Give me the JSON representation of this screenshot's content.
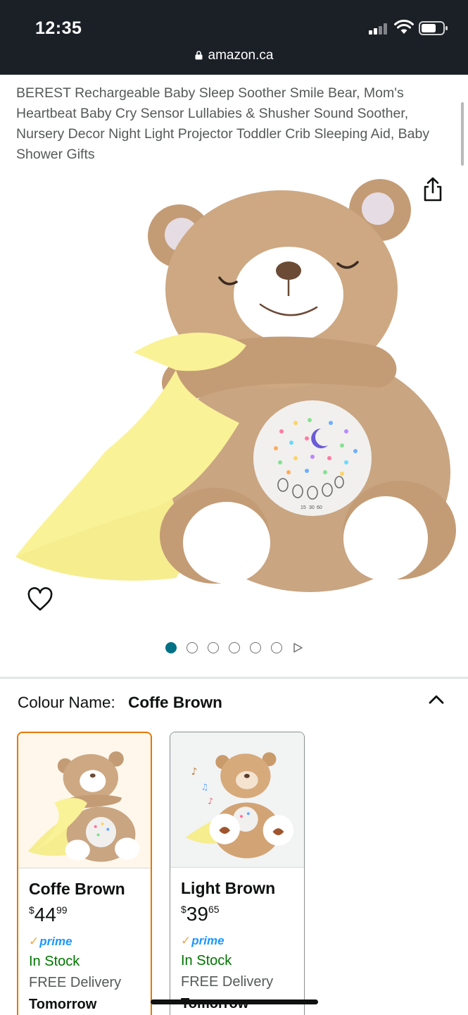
{
  "status_bar": {
    "time": "12:35"
  },
  "browser": {
    "url": "amazon.ca"
  },
  "product": {
    "title": "BEREST Rechargeable Baby Sleep Soother Smile Bear, Mom's Heartbeat Baby Cry Sensor Lullabies & Shusher Sound Soother, Nursery Decor Night Light Projector Toddler Crib Sleeping Aid, Baby Shower Gifts",
    "image": {
      "panel_labels": [
        "15",
        "30",
        "60"
      ]
    },
    "carousel": {
      "count": 6,
      "active_index": 0
    }
  },
  "variation": {
    "label": "Colour Name:",
    "selected": "Coffe Brown",
    "options": [
      {
        "name": "Coffe Brown",
        "price_currency": "$",
        "price_whole": "44",
        "price_fraction": "99",
        "prime": "prime",
        "stock": "In Stock",
        "delivery": "FREE Delivery",
        "delivery_when": "Tomorrow",
        "selected": true
      },
      {
        "name": "Light Brown",
        "price_currency": "$",
        "price_whole": "39",
        "price_fraction": "65",
        "prime": "prime",
        "stock": "In Stock",
        "delivery": "FREE Delivery",
        "delivery_when": "Tomorrow",
        "selected": false
      }
    ]
  },
  "colors": {
    "chrome_bg": "#1b2027",
    "selected_border": "#e77600",
    "dot_active": "#007185",
    "prime_blue": "#1a98ff",
    "stock_green": "#007600"
  }
}
